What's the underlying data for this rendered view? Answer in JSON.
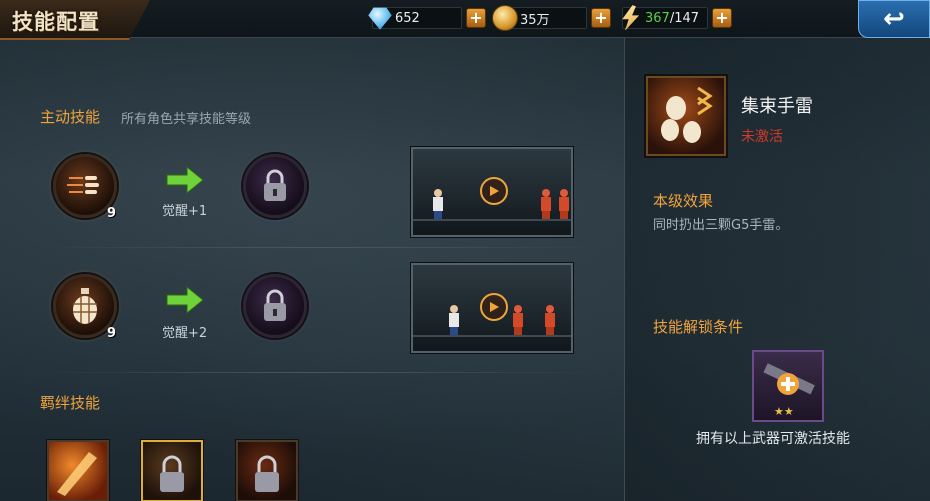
{
  "header": {
    "title": "技能配置",
    "gems": "652",
    "coins": "35万",
    "energy_current": "367",
    "energy_sep_max": "/147"
  },
  "active_skills": {
    "title": "主动技能",
    "subtitle": "所有角色共享技能等级",
    "rows": [
      {
        "level": "9",
        "awaken_label": "觉醒+1",
        "icon": "bullets-icon"
      },
      {
        "level": "9",
        "awaken_label": "觉醒+2",
        "icon": "grenade-icon"
      }
    ]
  },
  "bond_skills": {
    "title": "羁绊技能"
  },
  "detail": {
    "skill_name": "集束手雷",
    "status": "未激活",
    "effect_title": "本级效果",
    "effect_text": "同时扔出三颗G5手雷。",
    "unlock_title": "技能解锁条件",
    "unlock_text": "拥有以上武器可激活技能",
    "weapon_stars": 2
  },
  "colors": {
    "accent_orange": "#f1a43c",
    "inactive_red": "#d23a2a",
    "energy_green": "#5ad04a"
  }
}
